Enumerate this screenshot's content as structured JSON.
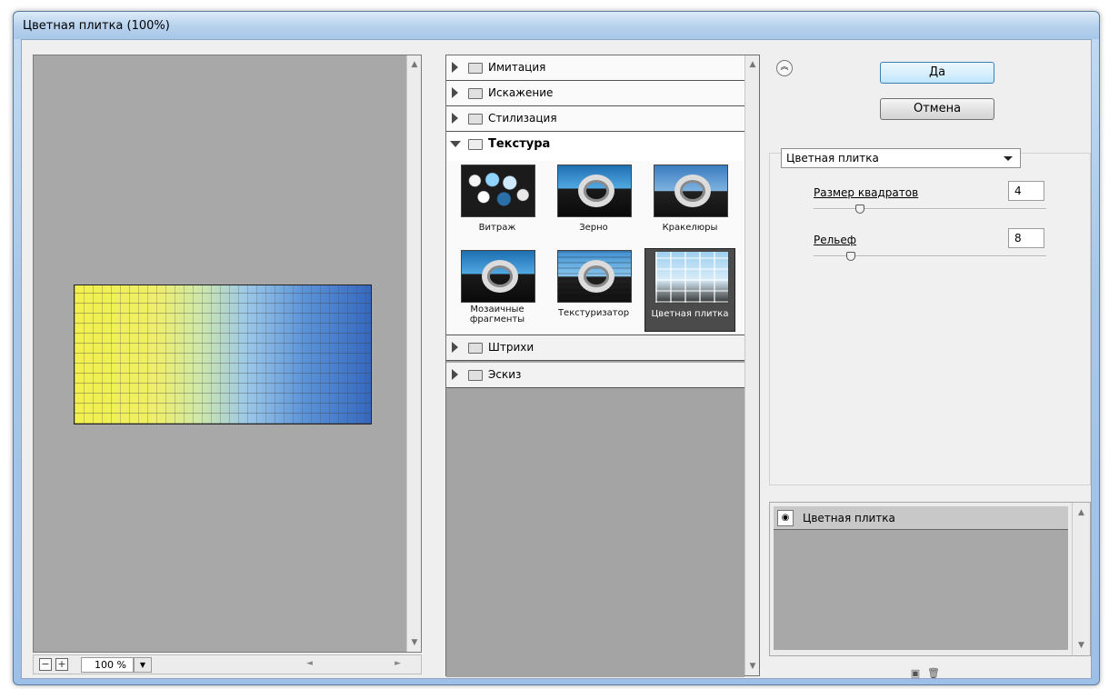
{
  "window": {
    "title": "Цветная плитка (100%)"
  },
  "preview": {
    "zoom_value": "100 %",
    "zoom_out_label": "−",
    "zoom_in_label": "+"
  },
  "gallery": {
    "categories": [
      {
        "label": "Имитация",
        "expanded": false
      },
      {
        "label": "Искажение",
        "expanded": false
      },
      {
        "label": "Стилизация",
        "expanded": false
      },
      {
        "label": "Текстура",
        "expanded": true
      },
      {
        "label": "Штрихи",
        "expanded": false
      },
      {
        "label": "Эскиз",
        "expanded": false
      }
    ],
    "texture_filters": [
      {
        "label": "Витраж",
        "selected": false
      },
      {
        "label": "Зерно",
        "selected": false
      },
      {
        "label": "Кракелюры",
        "selected": false
      },
      {
        "label": "Мозаичные фрагменты",
        "selected": false
      },
      {
        "label": "Текстуризатор",
        "selected": false
      },
      {
        "label": "Цветная плитка",
        "selected": true
      }
    ]
  },
  "buttons": {
    "ok": "Да",
    "cancel": "Отмена"
  },
  "settings": {
    "filter_select": "Цветная плитка",
    "params": [
      {
        "label": "Размер квадратов",
        "value": "4",
        "fraction": 0.2
      },
      {
        "label": "Рельеф",
        "value": "8",
        "fraction": 0.16
      }
    ]
  },
  "layers": {
    "items": [
      {
        "name": "Цветная плитка",
        "visible": true
      }
    ]
  },
  "icons": {
    "collapse": "double-chevron-up-icon",
    "new_layer": "new-layer-icon",
    "delete": "trash-icon"
  }
}
